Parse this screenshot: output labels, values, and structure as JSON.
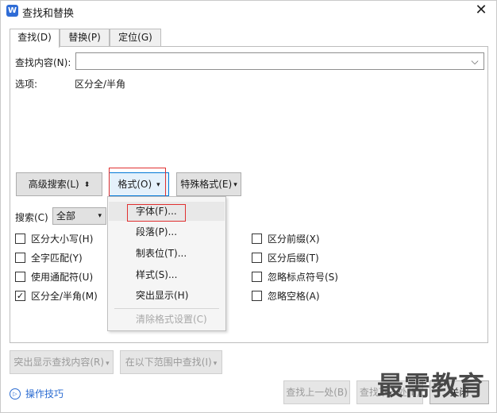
{
  "window": {
    "title": "查找和替换",
    "app_icon": "W",
    "close_glyph": "✕"
  },
  "tabs": [
    {
      "label": "查找(D)",
      "active": true
    },
    {
      "label": "替换(P)",
      "active": false
    },
    {
      "label": "定位(G)",
      "active": false
    }
  ],
  "find": {
    "label": "查找内容(N):",
    "value": "",
    "chevron": "⌵"
  },
  "options": {
    "label": "选项:",
    "value": "区分全/半角"
  },
  "buttons": {
    "advanced": "高级搜索(L)",
    "advanced_arrow": "⬍",
    "format": "格式(O)",
    "special": "特殊格式(E)",
    "dropdown_arrow": "▾"
  },
  "search": {
    "label": "搜索(C)",
    "value": "全部"
  },
  "checkboxes_left": [
    {
      "label": "区分大小写(H)",
      "checked": false
    },
    {
      "label": "全字匹配(Y)",
      "checked": false
    },
    {
      "label": "使用通配符(U)",
      "checked": false
    },
    {
      "label": "区分全/半角(M)",
      "checked": true
    }
  ],
  "checkboxes_right": [
    {
      "label": "区分前缀(X)",
      "checked": false
    },
    {
      "label": "区分后缀(T)",
      "checked": false
    },
    {
      "label": "忽略标点符号(S)",
      "checked": false
    },
    {
      "label": "忽略空格(A)",
      "checked": false
    }
  ],
  "checkmark": "✓",
  "format_menu": {
    "items": [
      {
        "label": "字体(F)...",
        "highlighted": true,
        "disabled": false
      },
      {
        "label": "段落(P)...",
        "highlighted": false,
        "disabled": false
      },
      {
        "label": "制表位(T)...",
        "highlighted": false,
        "disabled": false
      },
      {
        "label": "样式(S)...",
        "highlighted": false,
        "disabled": false
      },
      {
        "label": "突出显示(H)",
        "highlighted": false,
        "disabled": false
      },
      {
        "label": "清除格式设置(C)",
        "highlighted": false,
        "disabled": true
      }
    ]
  },
  "bottom": {
    "highlight_all": "突出显示查找内容(R)",
    "find_in": "在以下范围中查找(I)",
    "tips": "操作技巧",
    "tips_icon": "▷",
    "find_prev": "查找上一处(B)",
    "find_next": "查找下一处(F)",
    "close": "关闭"
  },
  "watermark": "最需教育",
  "colors": {
    "accent": "#0078d7",
    "highlight_box": "#e03030",
    "link": "#2a6bd1"
  }
}
